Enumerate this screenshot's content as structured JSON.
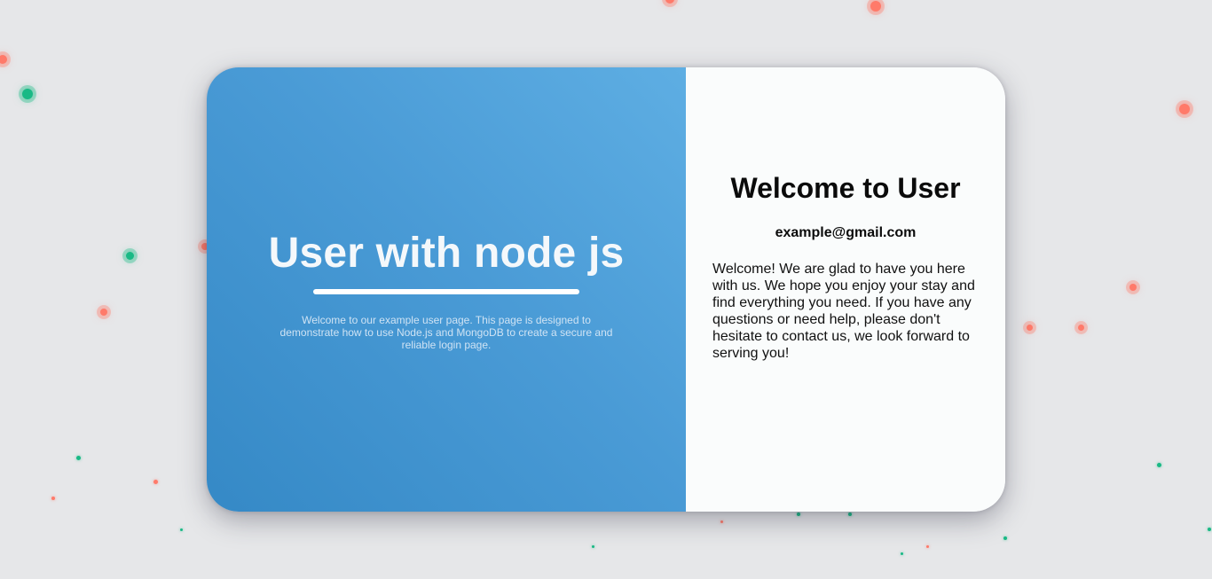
{
  "colors": {
    "background": "#e6e7e9",
    "left_panel_gradient": [
      "#5eaee3",
      "#3589c6"
    ],
    "right_panel": "#fafcfc",
    "dot_red": "#ff7a6a",
    "dot_green": "#19b985"
  },
  "left": {
    "title": "User with node js",
    "description": "Welcome to our example user page. This page is designed to demonstrate how to use Node.js and MongoDB to create a secure and reliable login page."
  },
  "right": {
    "title": "Welcome to User",
    "email": "example@gmail.com",
    "message": "Welcome! We are glad to have you here with us. We hope you enjoy your stay and find everything you need. If you have any questions or need help, please don't hesitate to contact us, we look forward to serving you!"
  }
}
